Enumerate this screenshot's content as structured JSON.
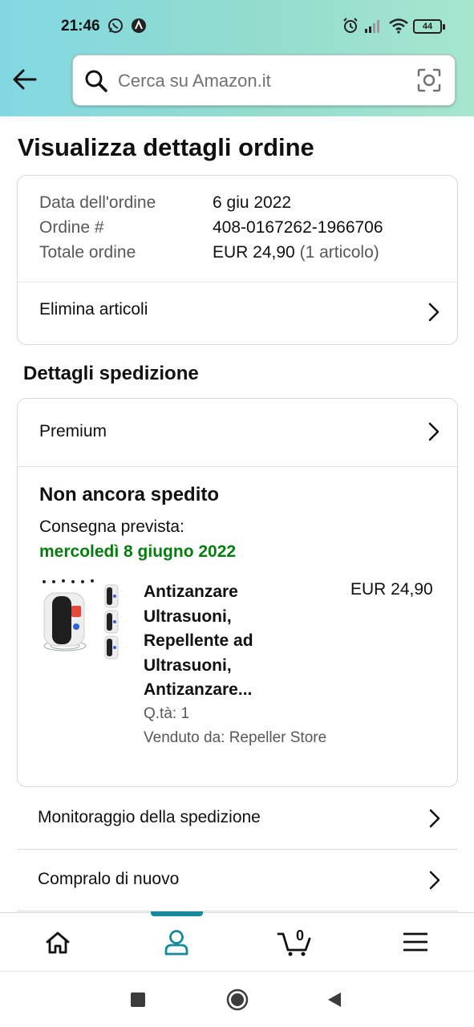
{
  "status_bar": {
    "time": "21:46",
    "battery": "44",
    "icons": [
      "whatsapp-icon",
      "app-notification-icon",
      "alarm-icon",
      "signal-icon",
      "wifi-icon",
      "battery-icon"
    ]
  },
  "header": {
    "back_icon": "arrow-left-icon",
    "search": {
      "placeholder": "Cerca su Amazon.it",
      "value": ""
    },
    "camera_icon": "camera-scan-icon"
  },
  "page_title": "Visualizza dettagli ordine",
  "order_summary": {
    "date_label": "Data dell'ordine",
    "date_value": "6 giu 2022",
    "order_label": "Ordine #",
    "order_value": "408-0167262-1966706",
    "total_label": "Totale ordine",
    "total_value": "EUR 24,90",
    "total_count": "(1 articolo)",
    "delete_items_label": "Elimina articoli"
  },
  "shipping": {
    "section_title": "Dettagli spedizione",
    "method": "Premium",
    "status": "Non ancora spedito",
    "eta_label": "Consegna prevista:",
    "eta_date": "mercoledì 8 giugno 2022",
    "product": {
      "title_lines": [
        "Antizanzare",
        "Ultrasuoni,",
        "Repellente ad",
        "Ultrasuoni,",
        "Antizanzare..."
      ],
      "price": "EUR 24,90",
      "qty": "Q.tà: 1",
      "seller": "Venduto da: Repeller Store"
    }
  },
  "actions": {
    "track": "Monitoraggio della spedizione",
    "buy_again": "Compralo di nuovo"
  },
  "bottom_nav": {
    "items": [
      "home-icon",
      "account-icon",
      "cart-icon",
      "menu-icon"
    ],
    "active": "account",
    "cart_count": "0"
  },
  "colors": {
    "header_gradient_start": "#82d8e3",
    "header_gradient_end": "#a6e6cf",
    "delivery_green": "#067d0f",
    "active_teal": "#168a9b"
  }
}
